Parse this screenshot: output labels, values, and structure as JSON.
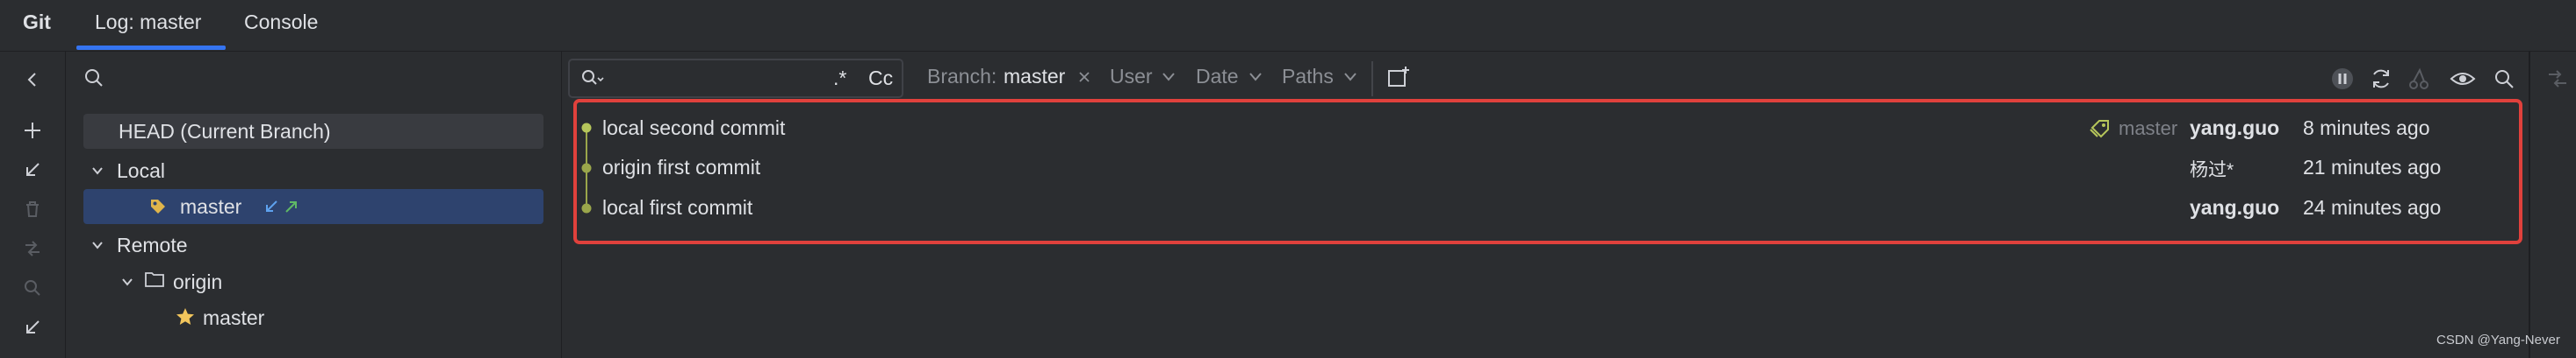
{
  "tabs": {
    "tool_window_title": "Git",
    "log_tab": "Log: master",
    "console_tab": "Console"
  },
  "branches_panel": {
    "head": "HEAD (Current Branch)",
    "local_group": "Local",
    "local_master": "master",
    "remote_group": "Remote",
    "origin_folder": "origin",
    "origin_master": "master"
  },
  "log_toolbar": {
    "regex_label": ".*",
    "case_label": "Cc",
    "branch_label": "Branch:",
    "branch_value": "master",
    "user_filter": "User",
    "date_filter": "Date",
    "paths_filter": "Paths"
  },
  "commits": [
    {
      "message": "local second commit",
      "ref": "master",
      "author": "yang.guo",
      "date": "8 minutes ago"
    },
    {
      "message": "origin first commit",
      "ref": "",
      "author": "杨过*",
      "date": "21 minutes ago"
    },
    {
      "message": "local first commit",
      "ref": "",
      "author": "yang.guo",
      "date": "24 minutes ago"
    }
  ],
  "watermark": "CSDN @Yang-Never",
  "colors": {
    "accent": "#3574f0",
    "selection": "#2e436e",
    "highlight_border": "#e0413c",
    "graph": "#9aa64b",
    "ref_tag": "#b6c65b"
  }
}
